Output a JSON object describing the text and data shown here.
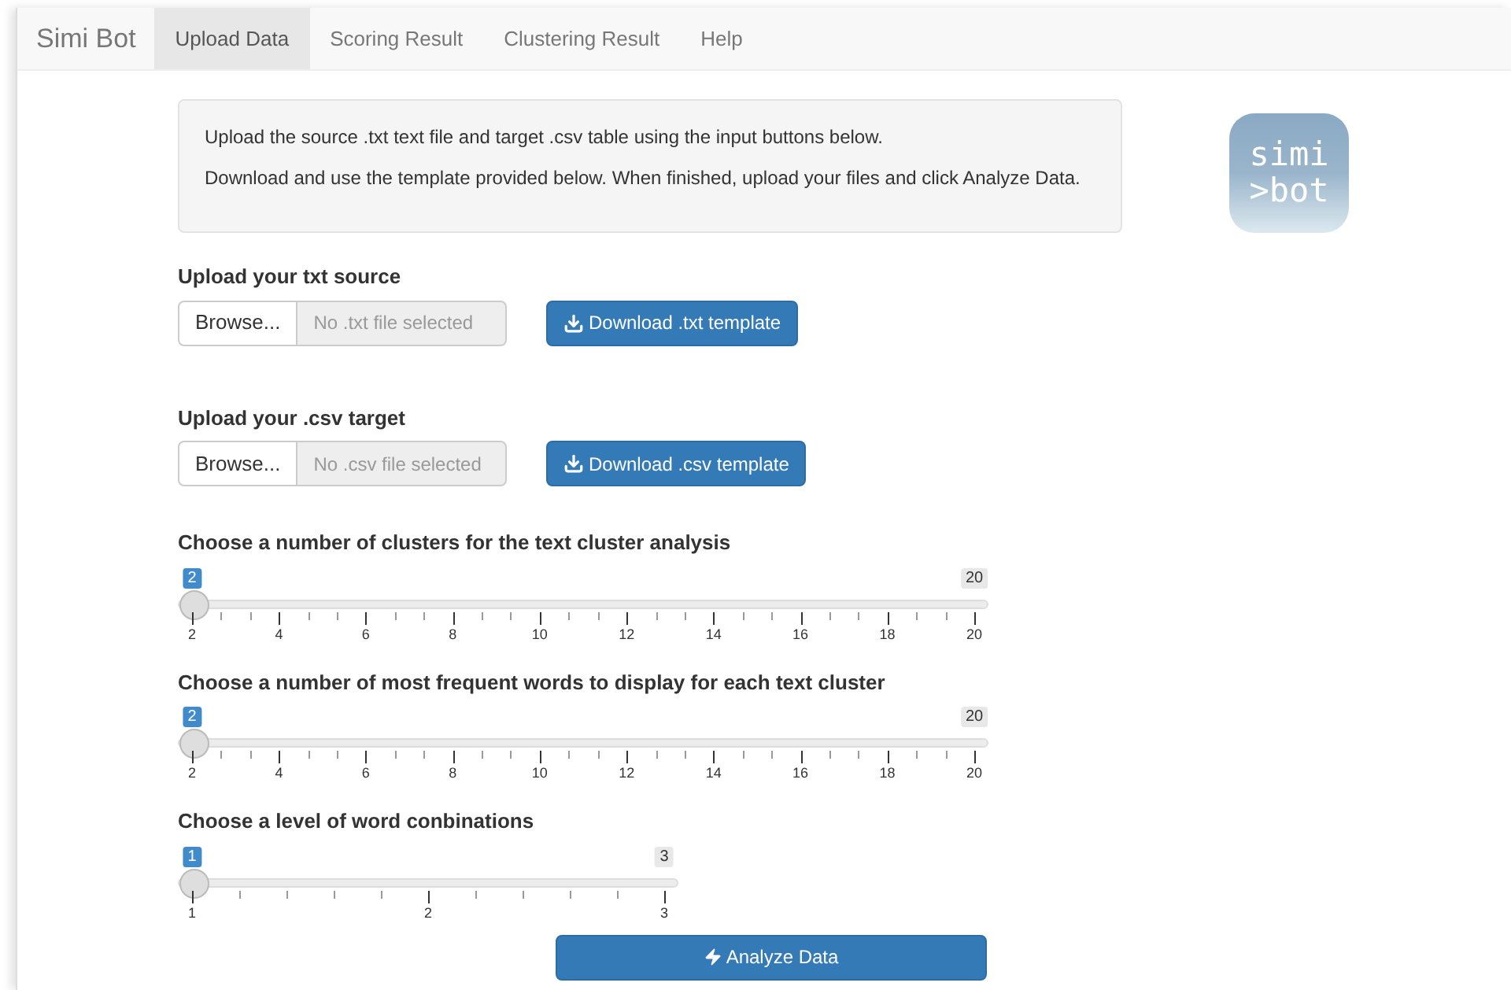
{
  "navbar": {
    "brand": "Simi Bot",
    "tabs": [
      {
        "label": "Upload Data",
        "selected": true
      },
      {
        "label": "Scoring Result",
        "selected": false
      },
      {
        "label": "Clustering Result",
        "selected": false
      },
      {
        "label": "Help",
        "selected": false
      }
    ]
  },
  "info_panel": {
    "lines": [
      "Upload the source .txt text file and target .csv table using the input buttons below.",
      "Download and use the template provided below. When finished, upload your files and click Analyze Data."
    ]
  },
  "logo": {
    "lines": [
      "simi",
      ">bot"
    ]
  },
  "uploads": [
    {
      "label": "Upload your txt source",
      "browse": "Browse...",
      "placeholder": "No .txt file selected",
      "download": "Download .txt template"
    },
    {
      "label": "Upload your .csv target",
      "browse": "Browse...",
      "placeholder": "No .csv file selected",
      "download": "Download .csv template"
    }
  ],
  "sliders": [
    {
      "label": "Choose a number of clusters for the text cluster analysis",
      "value": "2",
      "max_label": "20",
      "level": 0,
      "ticks": [
        "2",
        "4",
        "6",
        "8",
        "10",
        "12",
        "14",
        "16",
        "18",
        "20"
      ]
    },
    {
      "label": "Choose a number of most frequent words to display for each text cluster",
      "value": "2",
      "max_label": "20",
      "level": 0,
      "ticks": [
        "2",
        "4",
        "6",
        "8",
        "10",
        "12",
        "14",
        "16",
        "18",
        "20"
      ]
    },
    {
      "label": "Choose a level of word conbinations",
      "value": "1",
      "max_label": "3",
      "level": 0,
      "ticks": [
        "1",
        "2",
        "3"
      ]
    }
  ],
  "analyze_button": "Analyze Data"
}
